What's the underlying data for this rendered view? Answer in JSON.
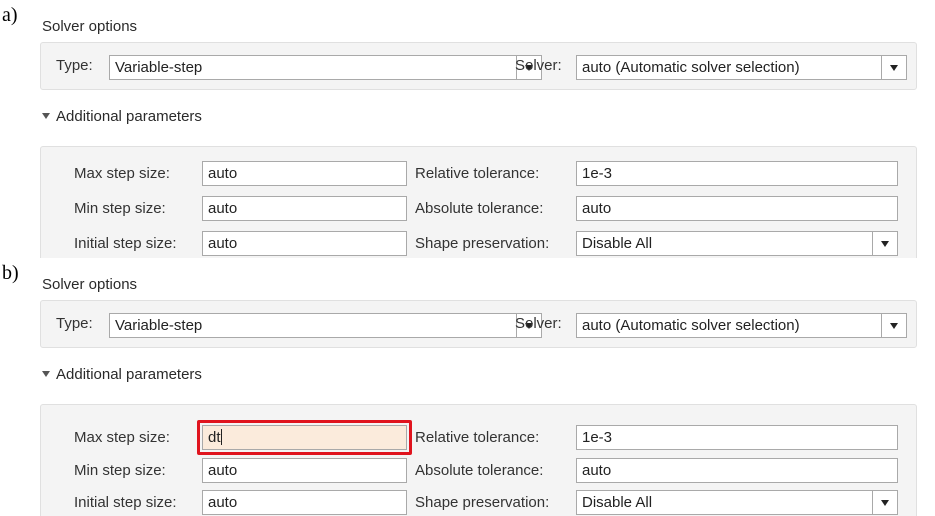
{
  "panels": [
    {
      "figure_label": "a)",
      "solver_options": {
        "title": "Solver options",
        "type_label": "Type:",
        "type_value": "Variable-step",
        "solver_label": "Solver:",
        "solver_value": "auto (Automatic solver selection)"
      },
      "additional": {
        "title": "Additional parameters",
        "max_step_label": "Max step size:",
        "max_step_value": "auto",
        "min_step_label": "Min step size:",
        "min_step_value": "auto",
        "initial_step_label": "Initial step size:",
        "initial_step_value": "auto",
        "rel_tol_label": "Relative tolerance:",
        "rel_tol_value": "1e-3",
        "abs_tol_label": "Absolute tolerance:",
        "abs_tol_value": "auto",
        "shape_label": "Shape preservation:",
        "shape_value": "Disable All"
      }
    },
    {
      "figure_label": "b)",
      "solver_options": {
        "title": "Solver options",
        "type_label": "Type:",
        "type_value": "Variable-step",
        "solver_label": "Solver:",
        "solver_value": "auto (Automatic solver selection)"
      },
      "additional": {
        "title": "Additional parameters",
        "max_step_label": "Max step size:",
        "max_step_value": "dt",
        "min_step_label": "Min step size:",
        "min_step_value": "auto",
        "initial_step_label": "Initial step size:",
        "initial_step_value": "auto",
        "rel_tol_label": "Relative tolerance:",
        "rel_tol_value": "1e-3",
        "abs_tol_label": "Absolute tolerance:",
        "abs_tol_value": "auto",
        "shape_label": "Shape preservation:",
        "shape_value": "Disable All"
      }
    }
  ],
  "colors": {
    "highlight": "#e0141e",
    "focused_field": "#fbebdc",
    "panel_background": "#f4f4f4"
  },
  "icons": {
    "dropdown": "chevron-down-icon",
    "collapse": "triangle-down-icon"
  }
}
